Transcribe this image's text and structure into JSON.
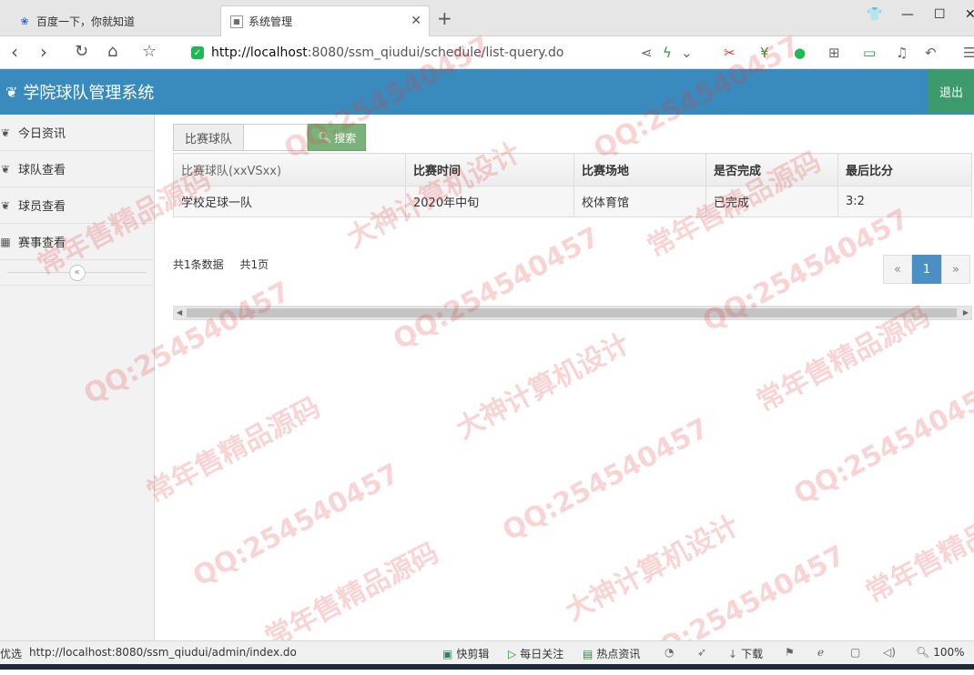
{
  "browser": {
    "tabs": [
      {
        "title": "百度一下，你就知道",
        "icon": "paw-icon"
      },
      {
        "title": "系统管理",
        "icon": "page-icon"
      }
    ],
    "new_tab_label": "+",
    "url_host": "http://localhost",
    "url_rest": ":8080/ssm_qiudui/schedule/list-query.do"
  },
  "app": {
    "brand": "学院球队管理系统",
    "logout": "退出",
    "accent": "#3a8bbd"
  },
  "sidebar": {
    "items": [
      {
        "label": "今日资讯",
        "icon": "leaf-icon"
      },
      {
        "label": "球队查看",
        "icon": "leaf-icon"
      },
      {
        "label": "球员查看",
        "icon": "leaf-icon"
      },
      {
        "label": "赛事查看",
        "icon": "calendar-icon"
      }
    ],
    "collapse": "«"
  },
  "search": {
    "label": "比赛球队",
    "value": "",
    "button": "搜索"
  },
  "table": {
    "headers": [
      "比赛球队(xxVSxx)",
      "比赛时间",
      "比赛场地",
      "是否完成",
      "最后比分"
    ],
    "rows": [
      [
        "学校足球一队",
        "2020年中旬",
        "校体育馆",
        "已完成",
        "3:2"
      ]
    ]
  },
  "pagination": {
    "total_records": "共1条数据",
    "total_pages": "共1页",
    "prev": "«",
    "current": "1",
    "next": "»"
  },
  "statusbar": {
    "left_text": "优选",
    "url": "http://localhost:8080/ssm_qiudui/admin/index.do",
    "items": [
      "快剪辑",
      "每日关注",
      "热点资讯",
      "下载",
      "100%"
    ]
  },
  "watermarks": [
    "QQ:254540457",
    "常年售精品源码",
    "大神计算机设计"
  ]
}
